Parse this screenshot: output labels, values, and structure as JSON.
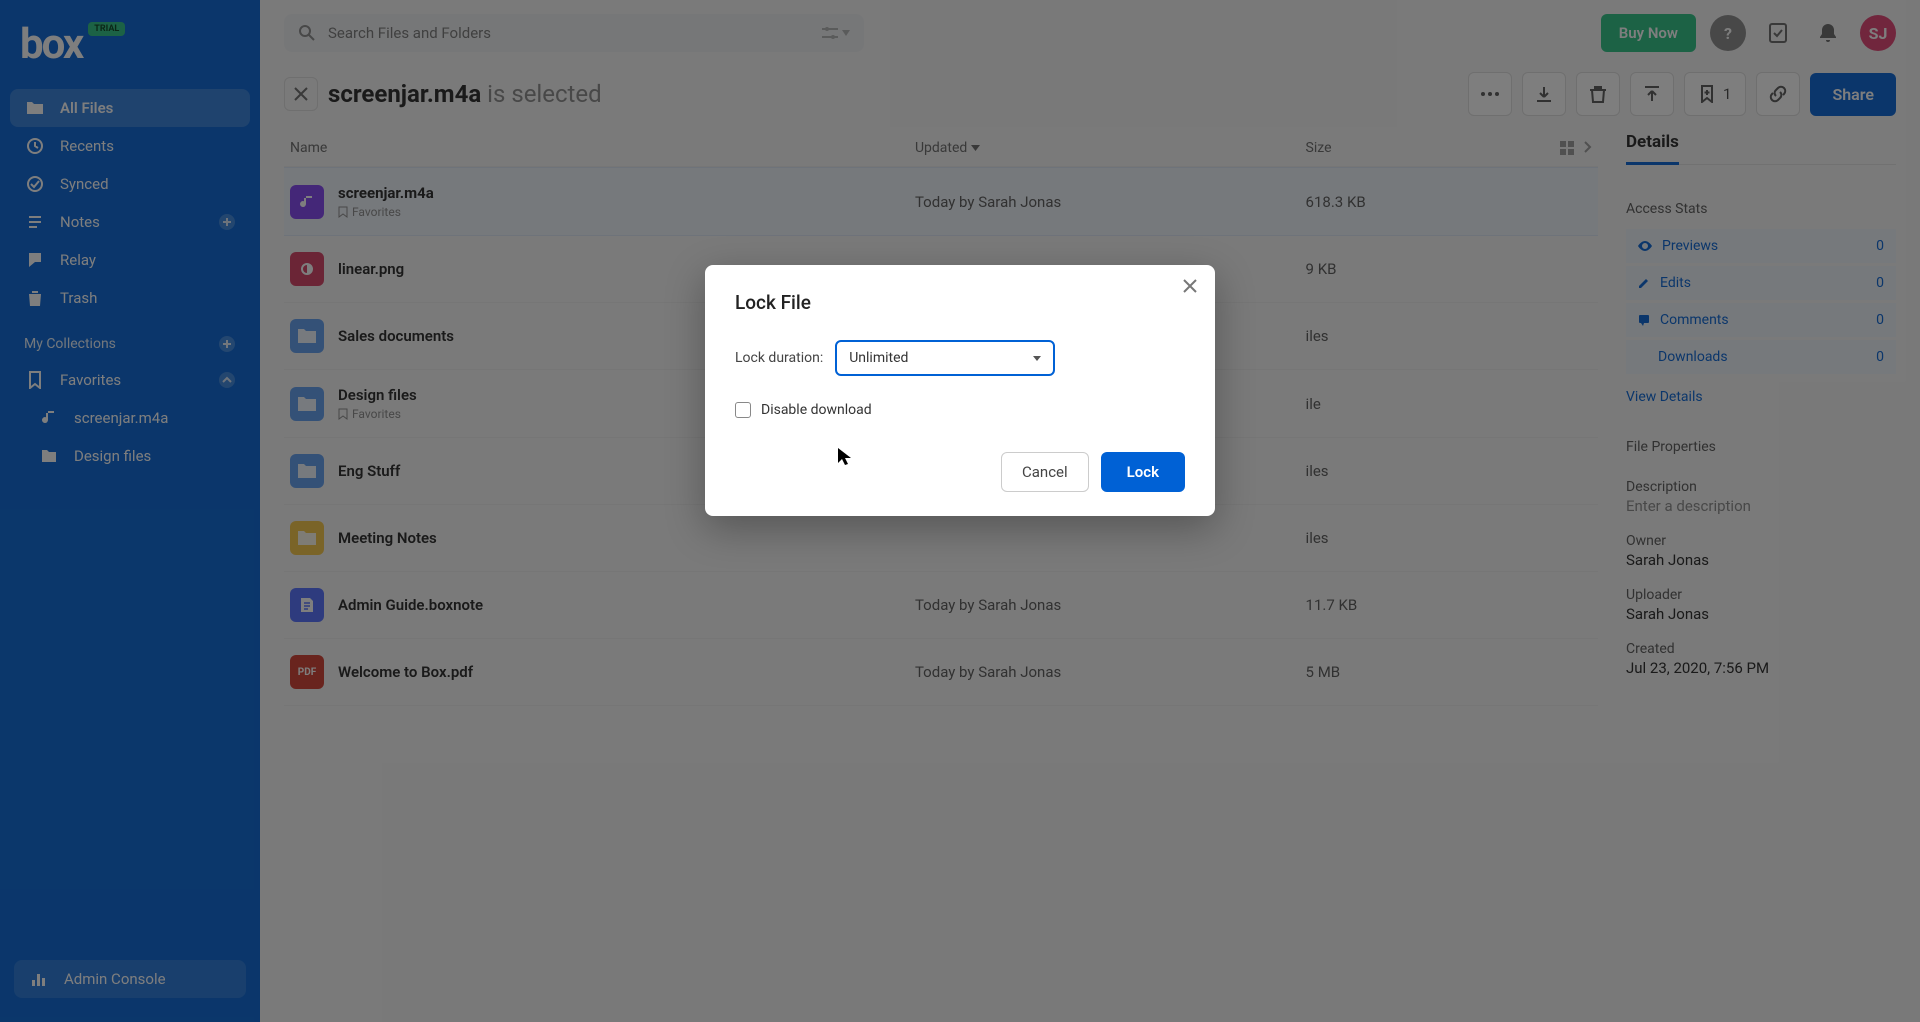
{
  "logo": {
    "text": "box",
    "badge": "TRIAL"
  },
  "search": {
    "placeholder": "Search Files and Folders"
  },
  "buy_label": "Buy Now",
  "avatar_initials": "SJ",
  "sidebar": {
    "items": [
      {
        "label": "All Files"
      },
      {
        "label": "Recents"
      },
      {
        "label": "Synced"
      },
      {
        "label": "Notes"
      },
      {
        "label": "Relay"
      },
      {
        "label": "Trash"
      }
    ],
    "collections_label": "My Collections",
    "favorites_label": "Favorites",
    "fav_items": [
      {
        "label": "screenjar.m4a"
      },
      {
        "label": "Design files"
      }
    ],
    "admin_label": "Admin Console"
  },
  "selection": {
    "filename": "screenjar.m4a",
    "suffix": "is selected",
    "collection_count": "1",
    "share_label": "Share"
  },
  "columns": {
    "name": "Name",
    "updated": "Updated",
    "size": "Size"
  },
  "files": [
    {
      "name": "screenjar.m4a",
      "fav": "Favorites",
      "updated": "Today by Sarah Jonas",
      "size": "618.3 KB",
      "icon": "audio",
      "selected": true
    },
    {
      "name": "linear.png",
      "updated": "",
      "size": "9 KB",
      "icon": "image"
    },
    {
      "name": "Sales documents",
      "updated": "",
      "size": "iles",
      "icon": "folder-blue"
    },
    {
      "name": "Design files",
      "fav": "Favorites",
      "updated": "",
      "size": "ile",
      "icon": "folder-blue"
    },
    {
      "name": "Eng Stuff",
      "updated": "",
      "size": "iles",
      "icon": "folder-blue"
    },
    {
      "name": "Meeting Notes",
      "updated": "",
      "size": "iles",
      "icon": "folder-yellow"
    },
    {
      "name": "Admin Guide.boxnote",
      "updated": "Today by Sarah Jonas",
      "size": "11.7 KB",
      "icon": "note"
    },
    {
      "name": "Welcome to Box.pdf",
      "updated": "Today by Sarah Jonas",
      "size": "5 MB",
      "icon": "pdf"
    }
  ],
  "details": {
    "title": "Details",
    "access_stats": "Access Stats",
    "stats": [
      {
        "label": "Previews",
        "value": "0"
      },
      {
        "label": "Edits",
        "value": "0"
      },
      {
        "label": "Comments",
        "value": "0"
      },
      {
        "label": "Downloads",
        "value": "0"
      }
    ],
    "view_details": "View Details",
    "props_title": "File Properties",
    "desc_label": "Description",
    "desc_placeholder": "Enter a description",
    "owner_label": "Owner",
    "owner_value": "Sarah Jonas",
    "uploader_label": "Uploader",
    "uploader_value": "Sarah Jonas",
    "created_label": "Created",
    "created_value": "Jul 23, 2020, 7:56 PM"
  },
  "modal": {
    "title": "Lock File",
    "duration_label": "Lock duration:",
    "duration_value": "Unlimited",
    "disable_download": "Disable download",
    "cancel": "Cancel",
    "lock": "Lock"
  }
}
